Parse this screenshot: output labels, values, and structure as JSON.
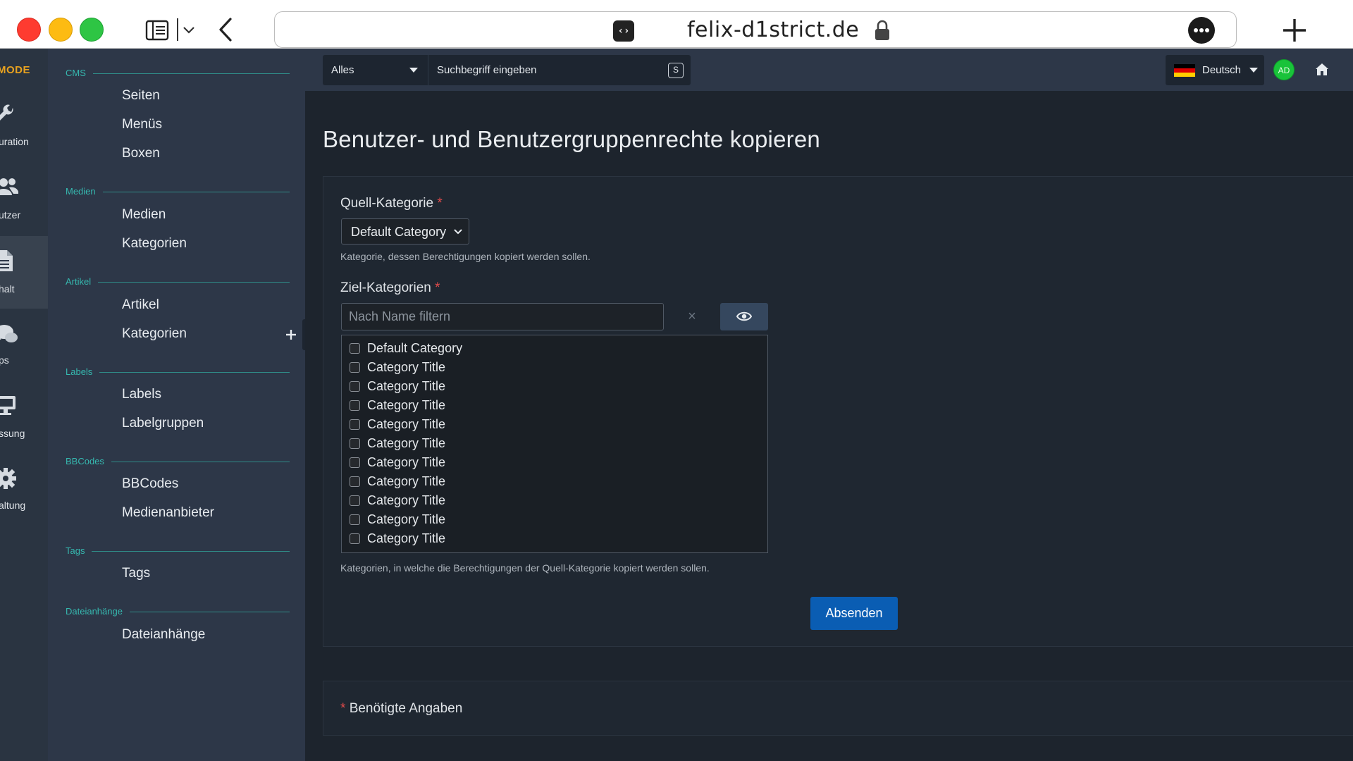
{
  "browser": {
    "url": "felix-d1strict.de",
    "code_glyph": "‹›"
  },
  "rail": {
    "logo": "MODE",
    "items": [
      {
        "label": "uration",
        "icon": "wrench-icon"
      },
      {
        "label": "utzer",
        "icon": "users-icon"
      },
      {
        "label": "halt",
        "icon": "document-icon"
      },
      {
        "label": "ps",
        "icon": "chat-icon"
      },
      {
        "label": "ssung",
        "icon": "monitor-icon"
      },
      {
        "label": "altung",
        "icon": "gear-icon"
      }
    ]
  },
  "sidebar": {
    "sections": [
      {
        "title": "CMS",
        "items": [
          {
            "label": "Seiten"
          },
          {
            "label": "Menüs"
          },
          {
            "label": "Boxen"
          }
        ]
      },
      {
        "title": "Medien",
        "items": [
          {
            "label": "Medien"
          },
          {
            "label": "Kategorien"
          }
        ]
      },
      {
        "title": "Artikel",
        "items": [
          {
            "label": "Artikel"
          },
          {
            "label": "Kategorien"
          }
        ]
      },
      {
        "title": "Labels",
        "items": [
          {
            "label": "Labels"
          },
          {
            "label": "Labelgruppen"
          }
        ]
      },
      {
        "title": "BBCodes",
        "items": [
          {
            "label": "BBCodes"
          },
          {
            "label": "Medienanbieter"
          }
        ]
      },
      {
        "title": "Tags",
        "items": [
          {
            "label": "Tags"
          }
        ]
      },
      {
        "title": "Dateianhänge",
        "items": [
          {
            "label": "Dateianhänge"
          }
        ]
      }
    ]
  },
  "topbar": {
    "search_scope": "Alles",
    "search_placeholder": "Suchbegriff eingeben",
    "search_shortcut": "S",
    "language": "Deutsch",
    "avatar_initials": "AD"
  },
  "main": {
    "title": "Benutzer- und Benutzergruppenrechte kopieren",
    "source_label": "Quell-Kategorie",
    "required_marker": "*",
    "source_value": "Default Category",
    "source_help": "Kategorie, dessen Berechtigungen kopiert werden sollen.",
    "target_label": "Ziel-Kategorien",
    "filter_placeholder": "Nach Name filtern",
    "clear_glyph": "×",
    "categories": [
      "Default Category",
      "Category Title",
      "Category Title",
      "Category Title",
      "Category Title",
      "Category Title",
      "Category Title",
      "Category Title",
      "Category Title",
      "Category Title",
      "Category Title"
    ],
    "target_help": "Kategorien, in welche die Berechtigungen der Quell-Kategorie kopiert werden sollen.",
    "submit_label": "Absenden",
    "required_note": "Benötigte Angaben"
  },
  "colors": {
    "accent": "#36b9b0",
    "primary_button": "#0a5db3",
    "required": "#e24b4b",
    "avatar": "#19c33a"
  }
}
